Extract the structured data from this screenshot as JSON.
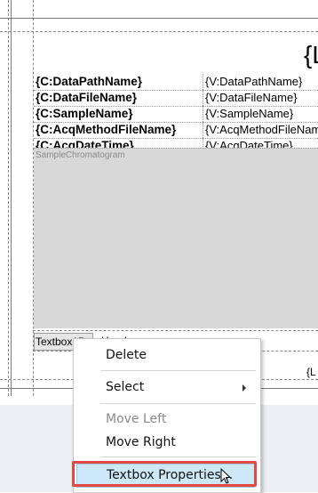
{
  "report": {
    "title_fragment": "{L",
    "footer_fragment": "{L",
    "fields": [
      {
        "label": "{C:DataPathName}",
        "value": "{V:DataPathName}"
      },
      {
        "label": "{C:DataFileName}",
        "value": "{V:DataFileName}"
      },
      {
        "label": "{C:SampleName}",
        "value": "{V:SampleName}"
      },
      {
        "label": "{C:AcqMethodFileName}",
        "value": "{V:AcqMethodFileName"
      },
      {
        "label": "{C:AcqDateTime}",
        "value": "{V:AcqDateTime}"
      }
    ],
    "chart_placeholder": "SampleChromatogram",
    "textbox_left": "Textbox15",
    "textbox_right": "Head"
  },
  "context_menu": {
    "items": [
      {
        "label": "Delete",
        "enabled": true
      },
      {
        "label": "Select",
        "enabled": true,
        "submenu": true
      },
      {
        "label": "Move Left",
        "enabled": false
      },
      {
        "label": "Move Right",
        "enabled": true
      },
      {
        "label": "Textbox Properties...",
        "enabled": true,
        "highlighted": true
      }
    ],
    "submenu_icon": "chevron-right-icon"
  },
  "colors": {
    "highlight_bg": "#cde8f8",
    "focus_ring": "#e24a3b",
    "chart_bg": "#d8d8d8"
  }
}
